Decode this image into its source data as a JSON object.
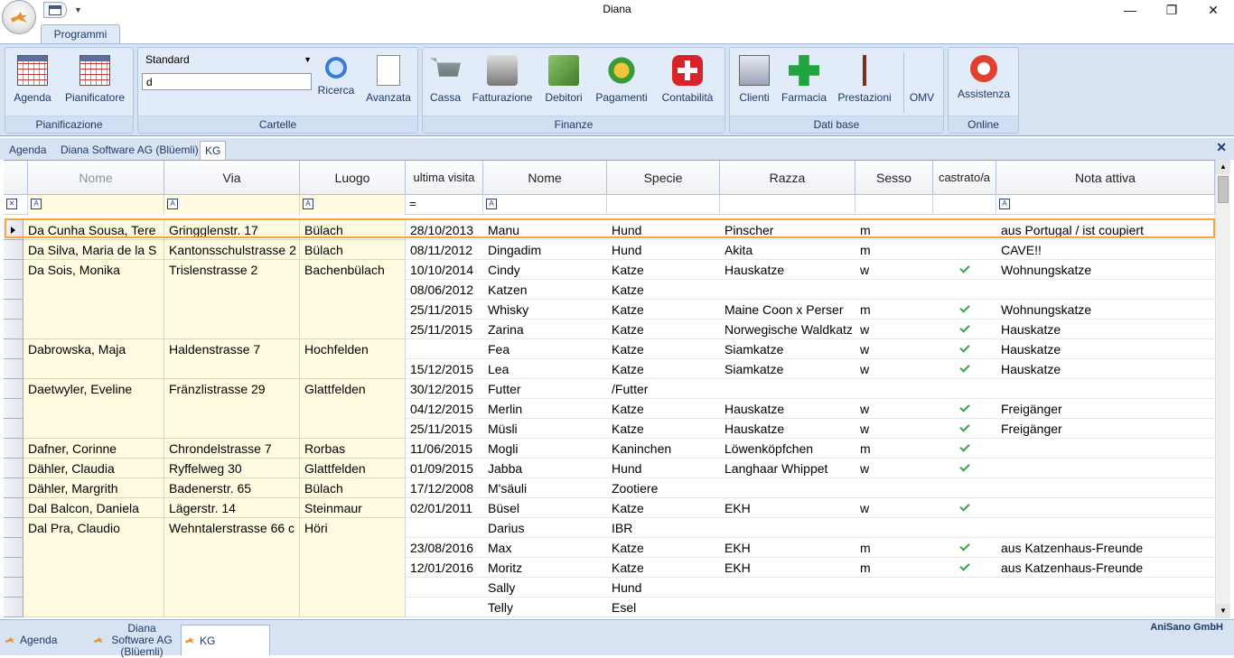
{
  "app": {
    "title": "Diana"
  },
  "ribbon": {
    "tab": "Programmi",
    "groups": {
      "pianificazione": {
        "label": "Pianificazione",
        "agenda": "Agenda",
        "pianificatore": "Pianificatore"
      },
      "cartelle": {
        "label": "Cartelle",
        "combo": "Standard",
        "search_value": "d",
        "ricerca": "Ricerca",
        "avanzata": "Avanzata"
      },
      "finanze": {
        "label": "Finanze",
        "cassa": "Cassa",
        "fatturazione": "Fatturazione",
        "debitori": "Debitori",
        "pagamenti": "Pagamenti",
        "contabilita": "Contabilità"
      },
      "datibase": {
        "label": "Dati base",
        "clienti": "Clienti",
        "farmacia": "Farmacia",
        "prestazioni": "Prestazioni",
        "omv": "OMV"
      },
      "online": {
        "label": "Online",
        "assistenza": "Assistenza"
      }
    }
  },
  "doc_tabs": [
    "Agenda",
    "Diana Software AG (Blüemli)",
    "KG"
  ],
  "grid": {
    "headers": {
      "nome_owner": "Nome",
      "via": "Via",
      "luogo": "Luogo",
      "ultima": "ultima visita",
      "nome": "Nome",
      "specie": "Specie",
      "razza": "Razza",
      "sesso": "Sesso",
      "castrato": "castrato/a",
      "nota": "Nota attiva"
    },
    "filter_eq": "=",
    "owners": [
      {
        "nome": "Da Cunha Sousa, Tere",
        "via": "Gringglenstr. 17",
        "luogo": "Bülach"
      },
      {
        "nome": "Da Silva, Maria de la S",
        "via": "Kantonsschulstrasse 2",
        "luogo": "Bülach"
      },
      {
        "nome": "Da Sois, Monika",
        "via": "Trislenstrasse 2",
        "luogo": "Bachenbülach"
      },
      {
        "nome": "Dabrowska, Maja",
        "via": "Haldenstrasse 7",
        "luogo": "Hochfelden"
      },
      {
        "nome": "Daetwyler, Eveline",
        "via": "Fränzlistrasse 29",
        "luogo": "Glattfelden"
      },
      {
        "nome": "Dafner, Corinne",
        "via": "Chrondelstrasse 7",
        "luogo": "Rorbas"
      },
      {
        "nome": "Dähler, Claudia",
        "via": "Ryffelweg 30",
        "luogo": "Glattfelden"
      },
      {
        "nome": "Dähler, Margrith",
        "via": "Badenerstr. 65",
        "luogo": "Bülach"
      },
      {
        "nome": "Dal Balcon, Daniela",
        "via": "Lägerstr. 14",
        "luogo": "Steinmaur"
      },
      {
        "nome": "Dal Pra, Claudio",
        "via": "Wehntalerstrasse 66 c",
        "luogo": "Höri"
      }
    ],
    "patients": [
      {
        "ultima": "28/10/2013",
        "nome": "Manu",
        "specie": "Hund",
        "razza": "Pinscher",
        "sesso": "m",
        "castrato": false,
        "nota": "aus Portugal / ist coupiert"
      },
      {
        "ultima": "08/11/2012",
        "nome": "Dingadim",
        "specie": "Hund",
        "razza": "Akita",
        "sesso": "m",
        "castrato": false,
        "nota": "CAVE!!"
      },
      {
        "ultima": "10/10/2014",
        "nome": "Cindy",
        "specie": "Katze",
        "razza": "Hauskatze",
        "sesso": "w",
        "castrato": true,
        "nota": "Wohnungskatze"
      },
      {
        "ultima": "08/06/2012",
        "nome": "Katzen",
        "specie": "Katze",
        "razza": "",
        "sesso": "",
        "castrato": false,
        "nota": ""
      },
      {
        "ultima": "25/11/2015",
        "nome": "Whisky",
        "specie": "Katze",
        "razza": "Maine Coon x Perser",
        "sesso": "m",
        "castrato": true,
        "nota": "Wohnungskatze"
      },
      {
        "ultima": "25/11/2015",
        "nome": "Zarina",
        "specie": "Katze",
        "razza": "Norwegische Waldkatz",
        "sesso": "w",
        "castrato": true,
        "nota": "Hauskatze"
      },
      {
        "ultima": "",
        "nome": "Fea",
        "specie": "Katze",
        "razza": "Siamkatze",
        "sesso": "w",
        "castrato": true,
        "nota": "Hauskatze"
      },
      {
        "ultima": "15/12/2015",
        "nome": "Lea",
        "specie": "Katze",
        "razza": "Siamkatze",
        "sesso": "w",
        "castrato": true,
        "nota": "Hauskatze"
      },
      {
        "ultima": "30/12/2015",
        "nome": "Futter",
        "specie": "/Futter",
        "razza": "",
        "sesso": "",
        "castrato": false,
        "nota": ""
      },
      {
        "ultima": "04/12/2015",
        "nome": "Merlin",
        "specie": "Katze",
        "razza": "Hauskatze",
        "sesso": "w",
        "castrato": true,
        "nota": "Freigänger"
      },
      {
        "ultima": "25/11/2015",
        "nome": "Müsli",
        "specie": "Katze",
        "razza": "Hauskatze",
        "sesso": "w",
        "castrato": true,
        "nota": "Freigänger"
      },
      {
        "ultima": "11/06/2015",
        "nome": "Mogli",
        "specie": "Kaninchen",
        "razza": "Löwenköpfchen",
        "sesso": "m",
        "castrato": true,
        "nota": ""
      },
      {
        "ultima": "01/09/2015",
        "nome": "Jabba",
        "specie": "Hund",
        "razza": "Langhaar Whippet",
        "sesso": "w",
        "castrato": true,
        "nota": ""
      },
      {
        "ultima": "17/12/2008",
        "nome": "M'säuli",
        "specie": "Zootiere",
        "razza": "",
        "sesso": "",
        "castrato": false,
        "nota": ""
      },
      {
        "ultima": "02/01/2011",
        "nome": "Büsel",
        "specie": "Katze",
        "razza": "EKH",
        "sesso": "w",
        "castrato": true,
        "nota": ""
      },
      {
        "ultima": "",
        "nome": "Darius",
        "specie": "IBR",
        "razza": "",
        "sesso": "",
        "castrato": false,
        "nota": ""
      },
      {
        "ultima": "23/08/2016",
        "nome": "Max",
        "specie": "Katze",
        "razza": "EKH",
        "sesso": "m",
        "castrato": true,
        "nota": "aus Katzenhaus-Freunde"
      },
      {
        "ultima": "12/01/2016",
        "nome": "Moritz",
        "specie": "Katze",
        "razza": "EKH",
        "sesso": "m",
        "castrato": true,
        "nota": "aus Katzenhaus-Freunde"
      },
      {
        "ultima": "",
        "nome": "Sally",
        "specie": "Hund",
        "razza": "",
        "sesso": "",
        "castrato": false,
        "nota": ""
      },
      {
        "ultima": "",
        "nome": "Telly",
        "specie": "Esel",
        "razza": "",
        "sesso": "",
        "castrato": false,
        "nota": ""
      }
    ],
    "owner_row_spans": [
      1,
      1,
      4,
      2,
      3,
      1,
      1,
      1,
      1,
      5
    ]
  },
  "bottom_tabs": [
    "Agenda",
    "Diana Software AG (Blüemli)",
    "KG"
  ],
  "brand": "AniSano GmbH",
  "colors": {
    "selection": "#f6a443",
    "owner_bg": "#fefbe1",
    "check": "#3aa04a",
    "ribbon": "#d7e3f3"
  }
}
